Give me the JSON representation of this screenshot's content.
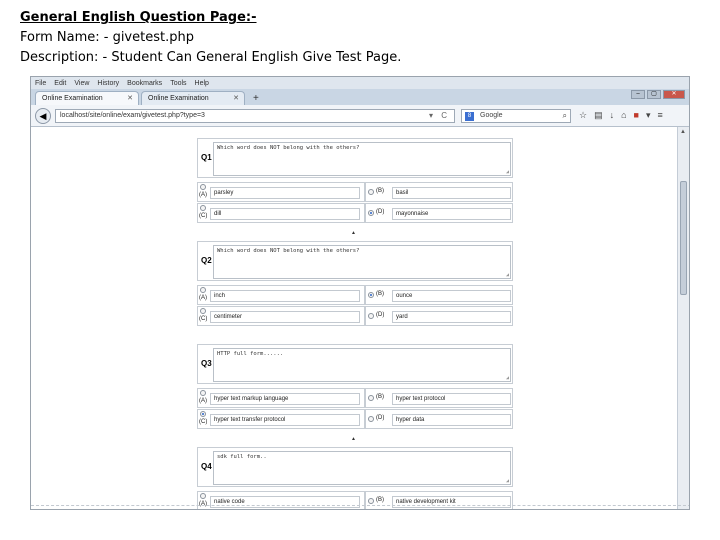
{
  "caption": {
    "heading": "General English Question Page:-",
    "form_name": "Form Name: - givetest.php",
    "description": "Description: - Student Can General English Give Test Page."
  },
  "browser": {
    "menu": [
      "File",
      "Edit",
      "View",
      "History",
      "Bookmarks",
      "Tools",
      "Help"
    ],
    "tabs": [
      {
        "label": "Online Examination",
        "active": true
      },
      {
        "label": "Online Examination",
        "active": false
      }
    ],
    "new_tab": "+",
    "url": "localhost/site/online/exam/givetest.php?type=3",
    "search_engine": "8",
    "search_placeholder": "Google",
    "icons": [
      "back-icon",
      "search-icon",
      "star-icon",
      "bookmarks-icon",
      "download-icon",
      "home-icon",
      "menu-icon"
    ]
  },
  "questions": [
    {
      "num": "Q1",
      "text": "Which word does NOT belong with the others?",
      "options": [
        {
          "letter": "(A)",
          "text": "parsley",
          "checked": false
        },
        {
          "letter": "(B)",
          "text": "basil",
          "checked": false
        },
        {
          "letter": "(C)",
          "text": "dill",
          "checked": false
        },
        {
          "letter": "(D)",
          "text": "mayonnaise",
          "checked": true
        }
      ]
    },
    {
      "num": "Q2",
      "text": "Which word does NOT belong with the others?",
      "options": [
        {
          "letter": "(A)",
          "text": "inch",
          "checked": false
        },
        {
          "letter": "(B)",
          "text": "ounce",
          "checked": true
        },
        {
          "letter": "(C)",
          "text": "centimeter",
          "checked": false
        },
        {
          "letter": "(D)",
          "text": "yard",
          "checked": false
        }
      ]
    },
    {
      "num": "Q3",
      "text": "HTTP full form......",
      "options": [
        {
          "letter": "(A)",
          "text": "hyper text markup language",
          "checked": false
        },
        {
          "letter": "(B)",
          "text": "hyper text protocol",
          "checked": false
        },
        {
          "letter": "(C)",
          "text": "hyper text transfer protocol",
          "checked": true
        },
        {
          "letter": "(D)",
          "text": "hyper data",
          "checked": false
        }
      ]
    },
    {
      "num": "Q4",
      "text": "sdk full form..",
      "options": [
        {
          "letter": "(A)",
          "text": "native code",
          "checked": false
        },
        {
          "letter": "(B)",
          "text": "native development kit",
          "checked": false
        }
      ]
    }
  ]
}
